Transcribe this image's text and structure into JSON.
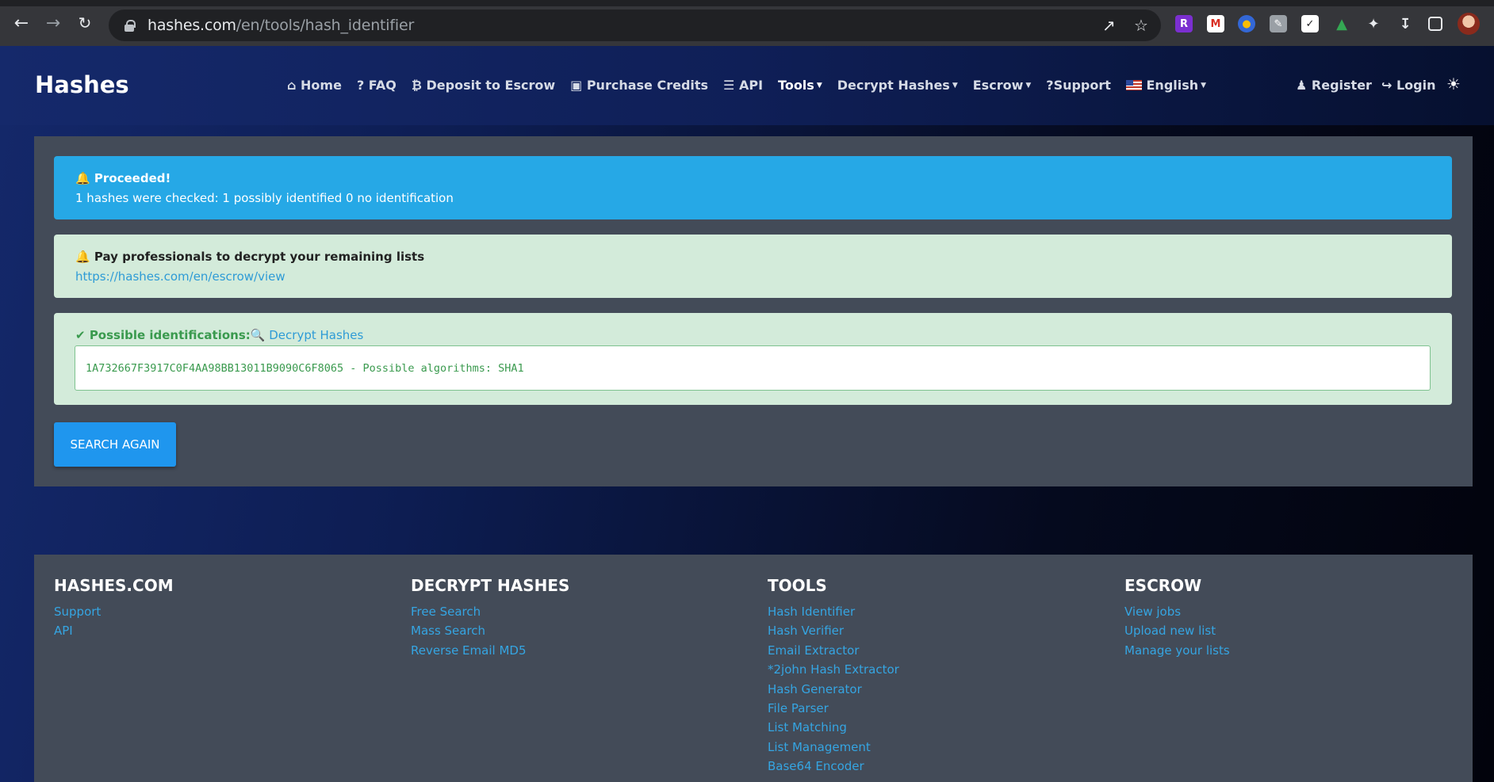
{
  "browser": {
    "url_host": "hashes.com",
    "url_path": "/en/tools/hash_identifier"
  },
  "navbar": {
    "brand": "Hashes",
    "items": [
      {
        "icon": "home-icon",
        "label": "Home"
      },
      {
        "icon": "question-icon",
        "label": "FAQ"
      },
      {
        "icon": "bitcoin-icon",
        "label": "Deposit to Escrow"
      },
      {
        "icon": "cart-icon",
        "label": "Purchase Credits"
      },
      {
        "icon": "api-icon",
        "label": "API"
      },
      {
        "icon": "",
        "label": "Tools",
        "dropdown": true,
        "active": true
      },
      {
        "icon": "",
        "label": "Decrypt Hashes",
        "dropdown": true
      },
      {
        "icon": "",
        "label": "Escrow",
        "dropdown": true
      },
      {
        "icon": "",
        "label": "?Support"
      },
      {
        "icon": "us-flag-icon",
        "label": "English",
        "dropdown": true
      }
    ],
    "register": "Register",
    "login": "Login"
  },
  "alerts": {
    "info_title": "Proceeded!",
    "info_text": "1 hashes were checked: 1 possibly identified 0 no identification",
    "promo_title": "Pay professionals to decrypt your remaining lists",
    "promo_link": "https://hashes.com/en/escrow/view",
    "result_title": "Possible identifications:",
    "result_link": "Decrypt Hashes",
    "result_text": "1A732667F3917C0F4AA98BB13011B9090C6F8065 - Possible algorithms: SHA1"
  },
  "search_again": "SEARCH AGAIN",
  "footer": {
    "columns": [
      {
        "title": "HASHES.COM",
        "links": [
          "Support",
          "API"
        ]
      },
      {
        "title": "DECRYPT HASHES",
        "links": [
          "Free Search",
          "Mass Search",
          "Reverse Email MD5"
        ]
      },
      {
        "title": "TOOLS",
        "links": [
          "Hash Identifier",
          "Hash Verifier",
          "Email Extractor",
          "*2john Hash Extractor",
          "Hash Generator",
          "File Parser",
          "List Matching",
          "List Management",
          "Base64 Encoder"
        ]
      },
      {
        "title": "ESCROW",
        "links": [
          "View jobs",
          "Upload new list",
          "Manage your lists"
        ]
      }
    ]
  },
  "colors": {
    "info": "#26a8e6",
    "success_bg": "#d3ebda",
    "link": "#35a5e2",
    "button": "#1f96ee"
  }
}
